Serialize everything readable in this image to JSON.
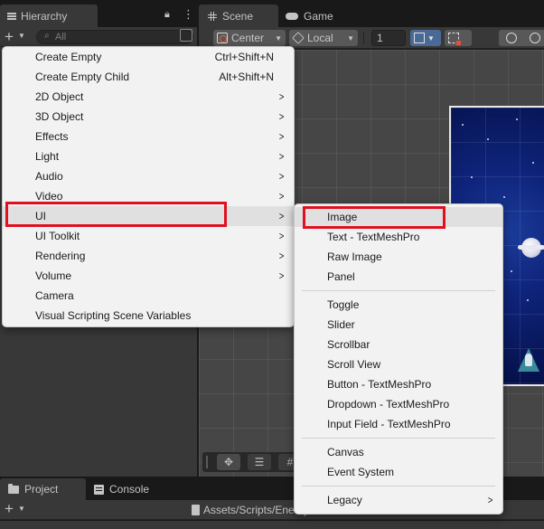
{
  "hierarchy": {
    "tab_label": "Hierarchy",
    "search_placeholder": "All",
    "add_button": "+"
  },
  "scene_panel": {
    "tabs": [
      {
        "label": "Scene"
      },
      {
        "label": "Game"
      }
    ],
    "toolbar": {
      "pivot_label": "Center",
      "space_label": "Local",
      "grid_count": "1"
    }
  },
  "bottom_panel": {
    "tabs": [
      {
        "label": "Project"
      },
      {
        "label": "Console"
      }
    ],
    "add_button": "+",
    "path": "Assets/Scripts/EnemyBase.cs"
  },
  "context_menu": {
    "items": [
      {
        "label": "Create Empty",
        "shortcut": "Ctrl+Shift+N"
      },
      {
        "label": "Create Empty Child",
        "shortcut": "Alt+Shift+N"
      },
      {
        "label": "2D Object",
        "submenu": true
      },
      {
        "label": "3D Object",
        "submenu": true
      },
      {
        "label": "Effects",
        "submenu": true
      },
      {
        "label": "Light",
        "submenu": true
      },
      {
        "label": "Audio",
        "submenu": true
      },
      {
        "label": "Video",
        "submenu": true
      },
      {
        "label": "UI",
        "submenu": true,
        "highlighted": true
      },
      {
        "label": "UI Toolkit",
        "submenu": true
      },
      {
        "label": "Rendering",
        "submenu": true
      },
      {
        "label": "Volume",
        "submenu": true
      },
      {
        "label": "Camera"
      },
      {
        "label": "Visual Scripting Scene Variables"
      }
    ]
  },
  "ui_submenu": {
    "groups": [
      [
        "Image",
        "Text - TextMeshPro",
        "Raw Image",
        "Panel"
      ],
      [
        "Toggle",
        "Slider",
        "Scrollbar",
        "Scroll View",
        "Button - TextMeshPro",
        "Dropdown - TextMeshPro",
        "Input Field - TextMeshPro"
      ],
      [
        "Canvas",
        "Event System"
      ],
      [
        "Legacy"
      ]
    ],
    "legacy_has_submenu": true
  },
  "colors": {
    "editor_bg": "#383838",
    "menu_bg": "#f2f2f2",
    "menu_highlight": "#e0e0e0",
    "annotation_red": "#e01020",
    "snap_active": "#4a6a96"
  }
}
